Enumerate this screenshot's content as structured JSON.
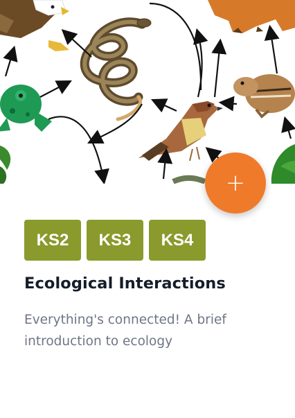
{
  "card": {
    "image_alt_icon": "food-web-illustration",
    "fab": {
      "icon": "plus-icon",
      "glyph": "+"
    },
    "tags": [
      "KS2",
      "KS3",
      "KS4"
    ],
    "title": "Ecological Interactions",
    "description": "Everything's connected! A brief introduction to ecology"
  },
  "colors": {
    "tag_bg": "#8a9a2c",
    "fab_bg": "#ef7a2a",
    "title": "#151d2a",
    "description": "#6f7586"
  }
}
